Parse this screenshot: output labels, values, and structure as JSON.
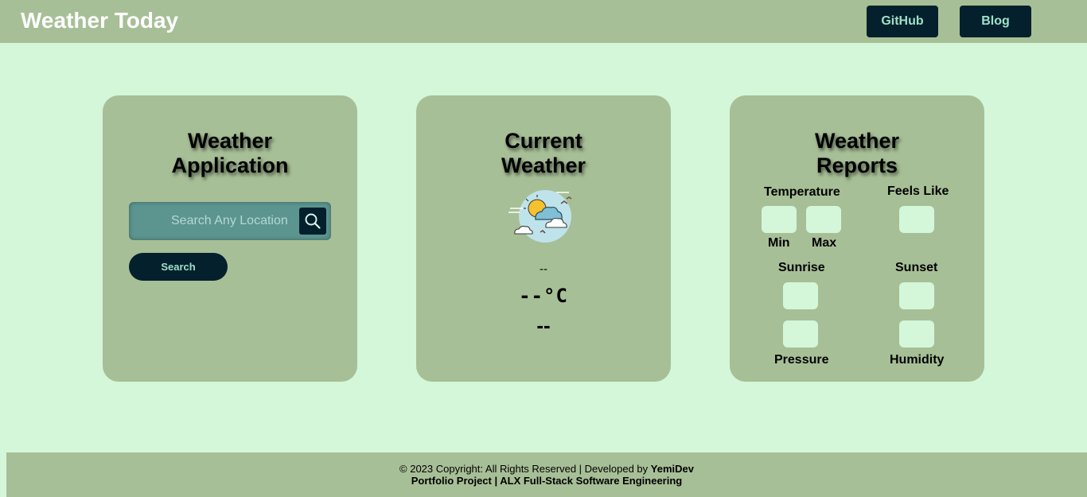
{
  "navbar": {
    "brand": "Weather Today",
    "github_label": "GitHub",
    "blog_label": "Blog"
  },
  "app_card": {
    "title_line1": "Weather",
    "title_line2": "Application",
    "search_placeholder": "Search Any Location",
    "search_value": "",
    "search_button_label": "Search"
  },
  "current_card": {
    "title_line1": "Current",
    "title_line2": "Weather",
    "weather_icon": "partly-cloudy-icon",
    "location": "--",
    "temperature": "--°C",
    "description": "--"
  },
  "reports_card": {
    "title_line1": "Weather",
    "title_line2": "Reports",
    "temperature_label": "Temperature",
    "min_label": "Min",
    "max_label": "Max",
    "min_value": "",
    "max_value": "",
    "feels_like_label": "Feels Like",
    "feels_like_value": "",
    "sunrise_label": "Sunrise",
    "sunrise_value": "",
    "sunset_label": "Sunset",
    "sunset_value": "",
    "pressure_label": "Pressure",
    "pressure_value": "",
    "humidity_label": "Humidity",
    "humidity_value": ""
  },
  "footer": {
    "copyright": "© 2023 Copyright: All Rights Reserved | Developed by ",
    "developer": "YemiDev",
    "line2": "Portfolio Project | ALX Full-Stack Software Engineering"
  },
  "colors": {
    "page_bg": "#d3f7d8",
    "panel_bg": "#a7bf96",
    "button_bg": "#03202c",
    "button_text": "#9fe0c8",
    "search_bg": "#5c9590"
  }
}
